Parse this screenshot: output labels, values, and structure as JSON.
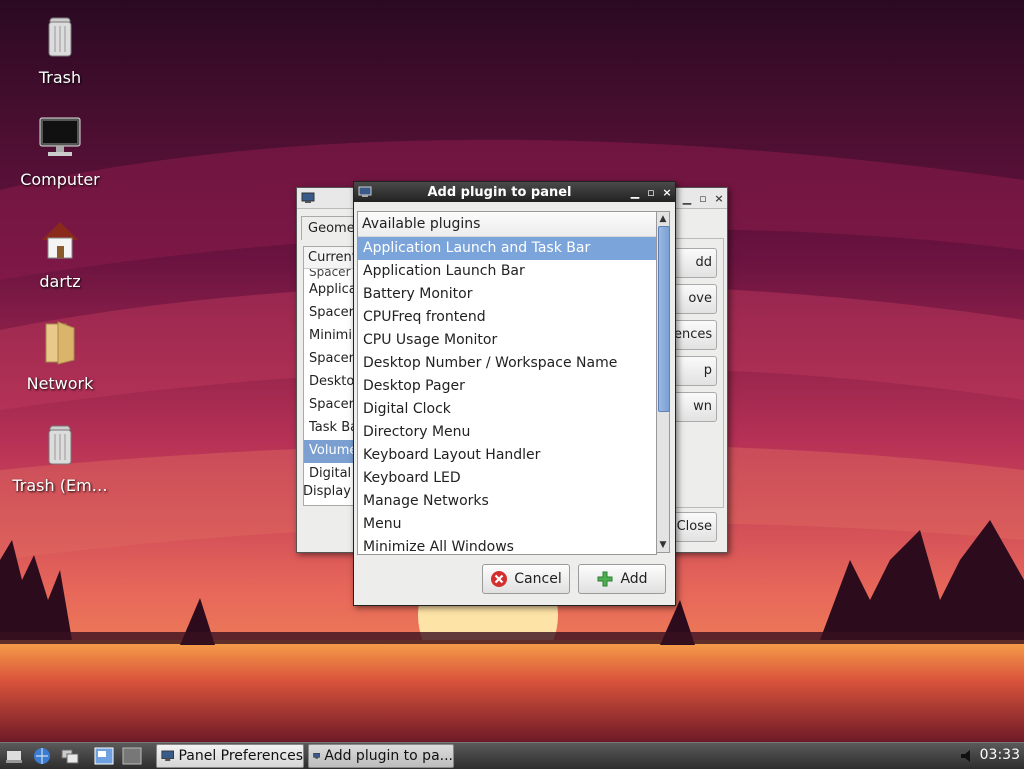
{
  "desktop": {
    "icons": [
      {
        "label": "Trash",
        "icon": "trash-icon"
      },
      {
        "label": "Computer",
        "icon": "computer-icon"
      },
      {
        "label": "dartz",
        "icon": "home-icon"
      },
      {
        "label": "Network",
        "icon": "folder-icon"
      },
      {
        "label": "Trash (Em…",
        "icon": "trash-icon"
      }
    ]
  },
  "panel_preferences": {
    "tab_label": "Geome",
    "list_header": "Current",
    "partial_item": "Spacer",
    "items": [
      "Applica",
      "Spacer",
      "Minimi",
      "Spacer",
      "Deskto",
      "Spacer",
      "Task Ba",
      "Volume",
      "Digital"
    ],
    "selected_index": 7,
    "display_label": "Display",
    "buttons": [
      "dd",
      "ove",
      "ences",
      "p",
      "wn"
    ],
    "close_label": "Close"
  },
  "add_plugin": {
    "title": "Add plugin to panel",
    "list_header": "Available plugins",
    "plugins": [
      "Application Launch and Task Bar",
      "Application Launch Bar",
      "Battery Monitor",
      "CPUFreq frontend",
      "CPU Usage Monitor",
      "Desktop Number / Workspace Name",
      "Desktop Pager",
      "Digital Clock",
      "Directory Menu",
      "Keyboard Layout Handler",
      "Keyboard LED",
      "Manage Networks",
      "Menu",
      "Minimize All Windows"
    ],
    "selected_index": 0,
    "cancel_label": "Cancel",
    "add_label": "Add"
  },
  "taskbar": {
    "tasks": [
      "Panel Preferences",
      "Add plugin to pa..."
    ],
    "clock": "03:33"
  }
}
